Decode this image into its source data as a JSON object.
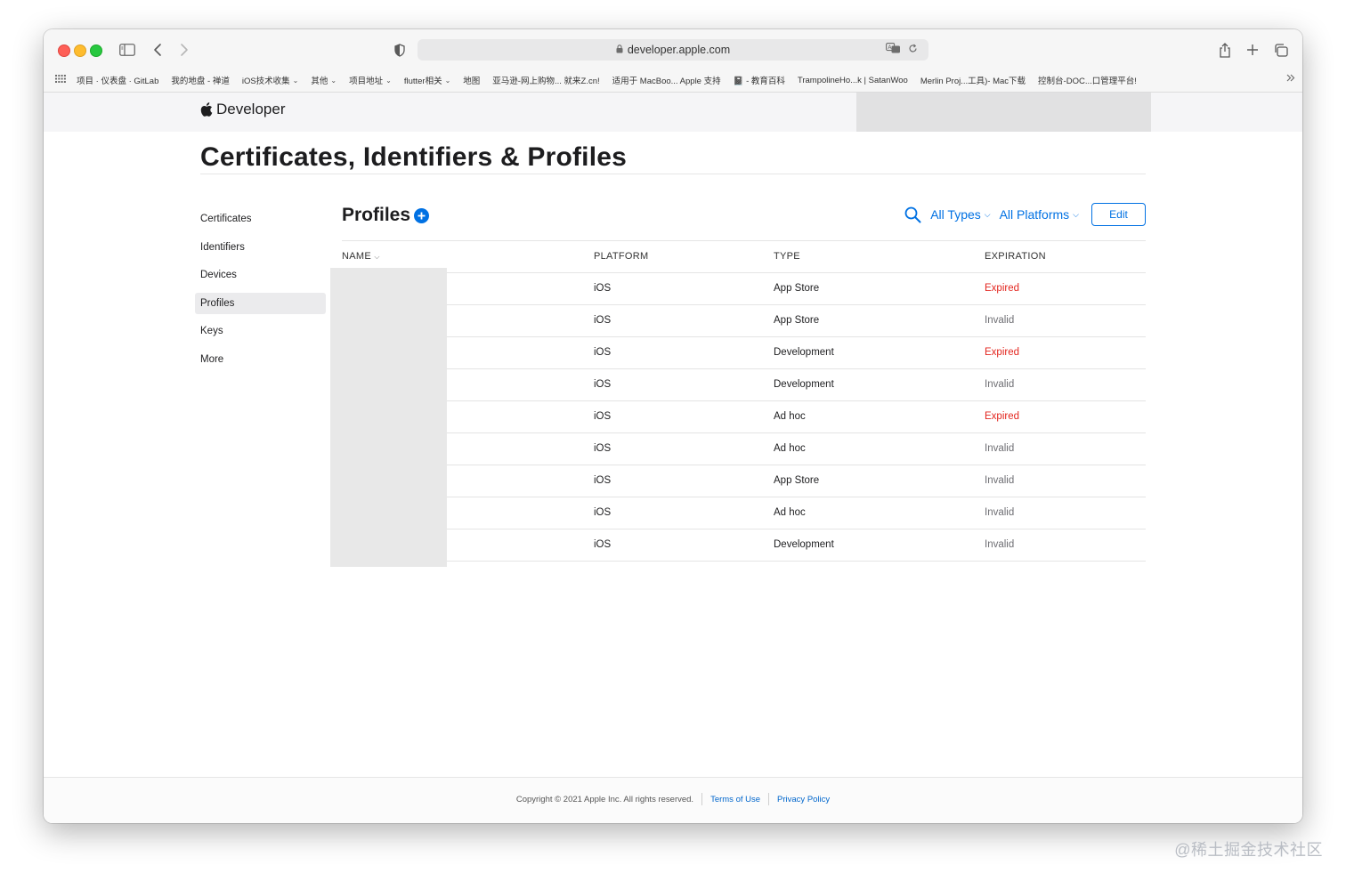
{
  "browser": {
    "url": "developer.apple.com",
    "bookmarks": [
      {
        "label": "项目 · 仪表盘 · GitLab",
        "dropdown": false
      },
      {
        "label": "我的地盘 - 禅道",
        "dropdown": false
      },
      {
        "label": "iOS技术收集",
        "dropdown": true
      },
      {
        "label": "其他",
        "dropdown": true
      },
      {
        "label": "项目地址",
        "dropdown": true
      },
      {
        "label": "flutter相关",
        "dropdown": true
      },
      {
        "label": "地图",
        "dropdown": false
      },
      {
        "label": "亚马逊-网上购物... 就来Z.cn!",
        "dropdown": false
      },
      {
        "label": "适用于 MacBoo... Apple 支持",
        "dropdown": false
      },
      {
        "label": "📓 - 教育百科",
        "dropdown": false
      },
      {
        "label": "TrampolineHo...k | SatanWoo",
        "dropdown": false
      },
      {
        "label": "Merlin Proj...工具)- Mac下载",
        "dropdown": false
      },
      {
        "label": "控制台-DOC...口管理平台!",
        "dropdown": false
      }
    ]
  },
  "nav": {
    "logo_text": "Developer"
  },
  "page_title": "Certificates, Identifiers & Profiles",
  "sidebar": {
    "items": [
      {
        "label": "Certificates",
        "active": false
      },
      {
        "label": "Identifiers",
        "active": false
      },
      {
        "label": "Devices",
        "active": false
      },
      {
        "label": "Profiles",
        "active": true
      },
      {
        "label": "Keys",
        "active": false
      },
      {
        "label": "More",
        "active": false
      }
    ]
  },
  "main": {
    "heading": "Profiles",
    "filters": {
      "types": "All Types",
      "platforms": "All Platforms"
    },
    "edit_label": "Edit",
    "columns": {
      "name": "NAME",
      "platform": "PLATFORM",
      "type": "TYPE",
      "expiration": "EXPIRATION"
    },
    "rows": [
      {
        "platform": "iOS",
        "type": "App Store",
        "expiration": "Expired"
      },
      {
        "platform": "iOS",
        "type": "App Store",
        "expiration": "Invalid"
      },
      {
        "platform": "iOS",
        "type": "Development",
        "expiration": "Expired"
      },
      {
        "platform": "iOS",
        "type": "Development",
        "expiration": "Invalid"
      },
      {
        "platform": "iOS",
        "type": "Ad hoc",
        "expiration": "Expired"
      },
      {
        "platform": "iOS",
        "type": "Ad hoc",
        "expiration": "Invalid"
      },
      {
        "platform": "iOS",
        "type": "App Store",
        "expiration": "Invalid"
      },
      {
        "platform": "iOS",
        "type": "Ad hoc",
        "expiration": "Invalid"
      },
      {
        "platform": "iOS",
        "type": "Development",
        "expiration": "Invalid"
      }
    ]
  },
  "footer": {
    "copyright": "Copyright © 2021 Apple Inc. All rights reserved.",
    "terms": "Terms of Use",
    "privacy": "Privacy Policy"
  },
  "watermark": "@稀土掘金技术社区",
  "colors": {
    "accent": "#0071e3",
    "expired": "#e3261f",
    "invalid": "#6e6e73"
  }
}
